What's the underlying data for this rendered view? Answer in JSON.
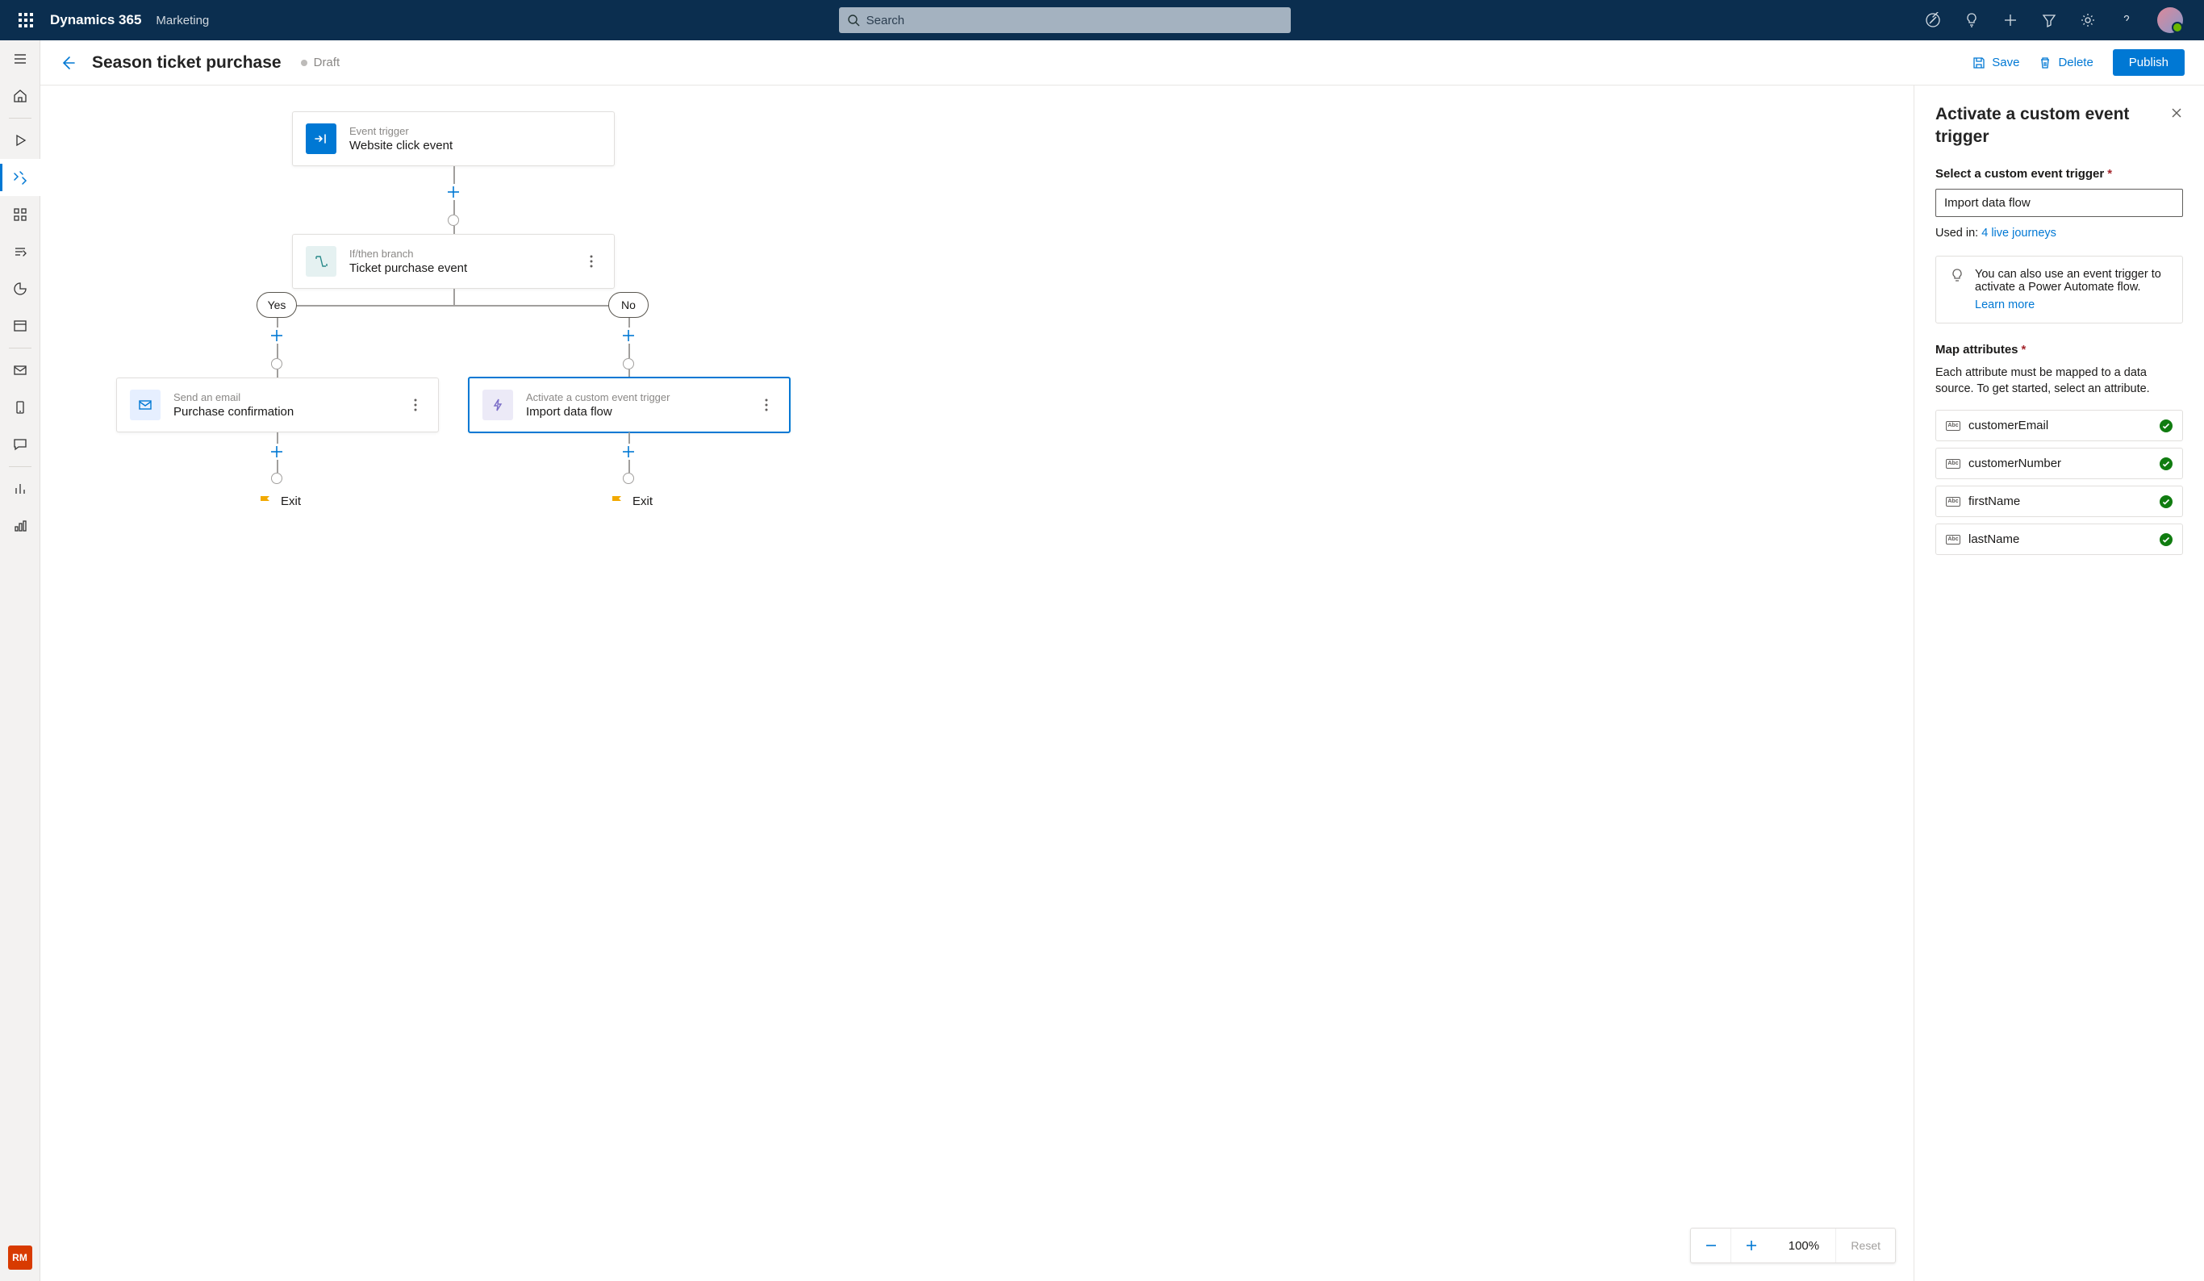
{
  "global": {
    "brand": "Dynamics 365",
    "module": "Marketing",
    "search_placeholder": "Search",
    "rm_badge": "RM"
  },
  "header": {
    "title": "Season ticket purchase",
    "status": "Draft",
    "save": "Save",
    "delete": "Delete",
    "publish": "Publish"
  },
  "journey": {
    "trigger": {
      "subtitle": "Event trigger",
      "title": "Website click event"
    },
    "branch": {
      "subtitle": "If/then branch",
      "title": "Ticket purchase event"
    },
    "yes": "Yes",
    "no": "No",
    "email": {
      "subtitle": "Send an email",
      "title": "Purchase confirmation"
    },
    "custom": {
      "subtitle": "Activate a custom event trigger",
      "title": "Import data flow"
    },
    "exit": "Exit"
  },
  "zoom": {
    "pct": "100%",
    "reset": "Reset"
  },
  "panel": {
    "title": "Activate a custom event trigger",
    "select_label": "Select a custom event trigger",
    "input_value": "Import data flow",
    "used_in_prefix": "Used in: ",
    "used_in_link": "4 live journeys",
    "info_text": "You can also use an event trigger to activate a Power Automate flow.",
    "learn_more": "Learn more",
    "map_label": "Map attributes",
    "map_help": "Each attribute must be mapped to a data source. To get started, select an attribute.",
    "attrs": [
      "customerEmail",
      "customerNumber",
      "firstName",
      "lastName"
    ]
  }
}
